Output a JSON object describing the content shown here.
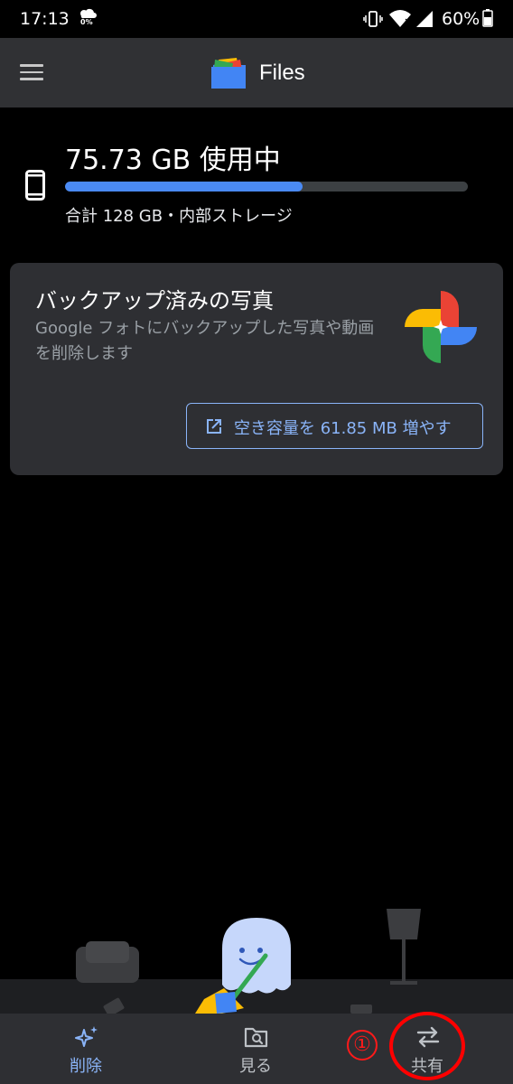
{
  "status_bar": {
    "time": "17:13",
    "weather_text": "0%",
    "battery": "60%"
  },
  "app_bar": {
    "title": "Files"
  },
  "storage": {
    "used_label": "75.73 GB 使用中",
    "total_label": "合計 128 GB・内部ストレージ",
    "used_fraction": 0.59
  },
  "card": {
    "title": "バックアップ済みの写真",
    "description": "Google フォトにバックアップした写真や動画を削除します",
    "button_label": "空き容量を 61.85 MB 増やす"
  },
  "bottom_nav": {
    "items": [
      {
        "label": "削除",
        "icon": "sparkle-icon",
        "active": true
      },
      {
        "label": "見る",
        "icon": "folder-search-icon",
        "active": false
      },
      {
        "label": "共有",
        "icon": "swap-arrows-icon",
        "active": false
      }
    ]
  },
  "annotation": {
    "number": "①"
  },
  "colors": {
    "accent": "#8ab4f8",
    "storage_fill": "#4a8af4",
    "app_bar": "#303134",
    "card": "#2e2f33",
    "annotation": "#ff0000"
  }
}
